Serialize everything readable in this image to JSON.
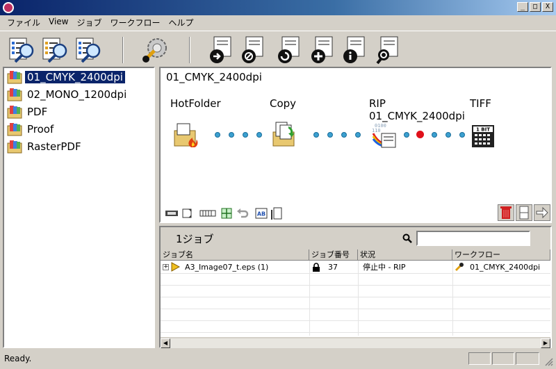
{
  "menu": [
    "ファイル",
    "View",
    "ジョブ",
    "ワークフロー",
    "ヘルプ"
  ],
  "window_buttons": {
    "minimize": "_",
    "maximize": "□",
    "close": "X"
  },
  "workflows": [
    {
      "label": "01_CMYK_2400dpi",
      "selected": true
    },
    {
      "label": "02_MONO_1200dpi",
      "selected": false
    },
    {
      "label": "PDF",
      "selected": false
    },
    {
      "label": "Proof",
      "selected": false
    },
    {
      "label": "RasterPDF",
      "selected": false
    }
  ],
  "diagram": {
    "title": "01_CMYK_2400dpi",
    "nodes": [
      {
        "label": "HotFolder"
      },
      {
        "label": "Copy"
      },
      {
        "label": "RIP\n01_CMYK_2400dpi"
      },
      {
        "label": "TIFF"
      }
    ],
    "tiff_badge": "1 BIT",
    "ab_label": "AB"
  },
  "jobs": {
    "count_label": "1ジョブ",
    "columns": [
      "ジョブ名",
      "ジョブ番号",
      "状況",
      "ワークフロー"
    ],
    "rows": [
      {
        "name": "A3_Image07_t.eps (1)",
        "number": "37",
        "status": "停止中 - RIP",
        "workflow": "01_CMYK_2400dpi"
      }
    ],
    "expand": "+"
  },
  "status": {
    "text": "Ready."
  },
  "colors": {
    "selection": "#0a246a",
    "dot": "#3ca0d0",
    "stop": "#e0101a",
    "delete": "#d02020"
  }
}
